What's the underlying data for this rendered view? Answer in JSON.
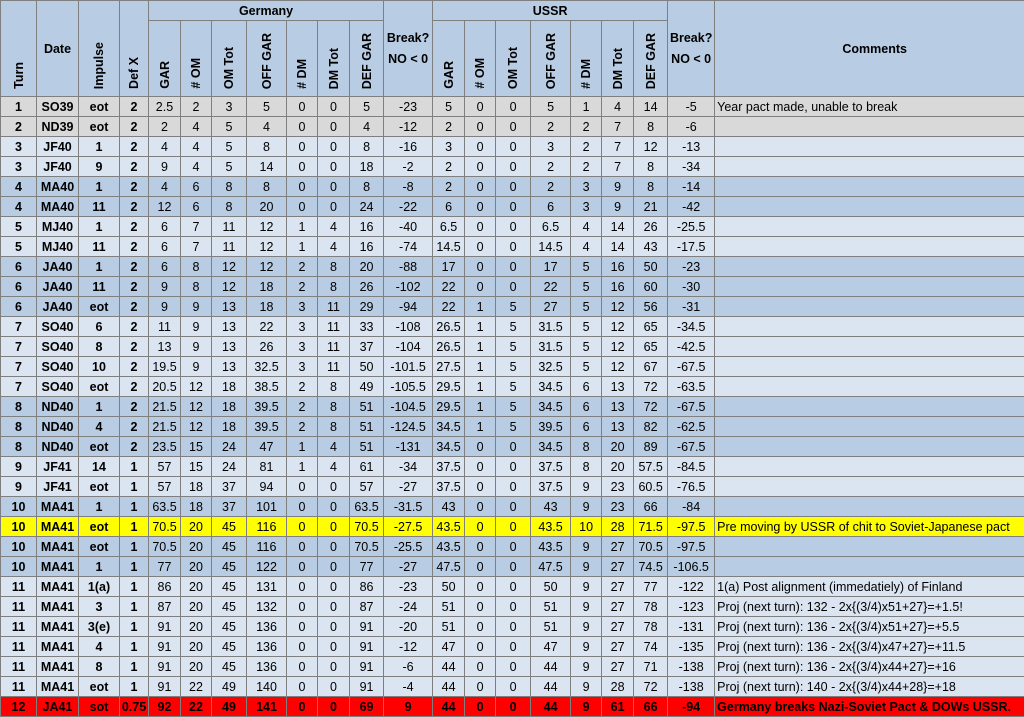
{
  "headers": {
    "turn": "Turn",
    "date": "Date",
    "impulse": "Impulse",
    "defx": "Def X",
    "germany": "Germany",
    "ussr": "USSR",
    "gar": "GAR",
    "om": "# OM",
    "omtot": "OM Tot",
    "offgar": "OFF GAR",
    "dm": "# DM",
    "dmtot": "DM Tot",
    "defgar": "DEF GAR",
    "break1": "Break?",
    "break2": "NO < 0",
    "comments": "Comments"
  },
  "rows": [
    {
      "style": "gray",
      "turn": "1",
      "date": "SO39",
      "impulse": "eot",
      "defx": "2",
      "g": [
        "2.5",
        "2",
        "3",
        "5",
        "0",
        "0",
        "5"
      ],
      "gbrk": "-23",
      "u": [
        "5",
        "0",
        "0",
        "5",
        "1",
        "4",
        "14"
      ],
      "ubrk": "-5",
      "comment": "Year pact made, unable to break"
    },
    {
      "style": "gray",
      "turn": "2",
      "date": "ND39",
      "impulse": "eot",
      "defx": "2",
      "g": [
        "2",
        "4",
        "5",
        "4",
        "0",
        "0",
        "4"
      ],
      "gbrk": "-12",
      "u": [
        "2",
        "0",
        "0",
        "2",
        "2",
        "7",
        "8"
      ],
      "ubrk": "-6",
      "comment": ""
    },
    {
      "style": "light",
      "turn": "3",
      "date": "JF40",
      "impulse": "1",
      "defx": "2",
      "g": [
        "4",
        "4",
        "5",
        "8",
        "0",
        "0",
        "8"
      ],
      "gbrk": "-16",
      "u": [
        "3",
        "0",
        "0",
        "3",
        "2",
        "7",
        "12"
      ],
      "ubrk": "-13",
      "comment": ""
    },
    {
      "style": "light",
      "turn": "3",
      "date": "JF40",
      "impulse": "9",
      "defx": "2",
      "g": [
        "9",
        "4",
        "5",
        "14",
        "0",
        "0",
        "18"
      ],
      "gbrk": "-2",
      "u": [
        "2",
        "0",
        "0",
        "2",
        "2",
        "7",
        "8"
      ],
      "ubrk": "-34",
      "comment": ""
    },
    {
      "style": "dark",
      "turn": "4",
      "date": "MA40",
      "impulse": "1",
      "defx": "2",
      "g": [
        "4",
        "6",
        "8",
        "8",
        "0",
        "0",
        "8"
      ],
      "gbrk": "-8",
      "u": [
        "2",
        "0",
        "0",
        "2",
        "3",
        "9",
        "8"
      ],
      "ubrk": "-14",
      "comment": ""
    },
    {
      "style": "dark",
      "turn": "4",
      "date": "MA40",
      "impulse": "11",
      "defx": "2",
      "g": [
        "12",
        "6",
        "8",
        "20",
        "0",
        "0",
        "24"
      ],
      "gbrk": "-22",
      "u": [
        "6",
        "0",
        "0",
        "6",
        "3",
        "9",
        "21"
      ],
      "ubrk": "-42",
      "comment": ""
    },
    {
      "style": "light",
      "turn": "5",
      "date": "MJ40",
      "impulse": "1",
      "defx": "2",
      "g": [
        "6",
        "7",
        "11",
        "12",
        "1",
        "4",
        "16"
      ],
      "gbrk": "-40",
      "u": [
        "6.5",
        "0",
        "0",
        "6.5",
        "4",
        "14",
        "26"
      ],
      "ubrk": "-25.5",
      "comment": ""
    },
    {
      "style": "light",
      "turn": "5",
      "date": "MJ40",
      "impulse": "11",
      "defx": "2",
      "g": [
        "6",
        "7",
        "11",
        "12",
        "1",
        "4",
        "16"
      ],
      "gbrk": "-74",
      "u": [
        "14.5",
        "0",
        "0",
        "14.5",
        "4",
        "14",
        "43"
      ],
      "ubrk": "-17.5",
      "comment": ""
    },
    {
      "style": "dark",
      "turn": "6",
      "date": "JA40",
      "impulse": "1",
      "defx": "2",
      "g": [
        "6",
        "8",
        "12",
        "12",
        "2",
        "8",
        "20"
      ],
      "gbrk": "-88",
      "u": [
        "17",
        "0",
        "0",
        "17",
        "5",
        "16",
        "50"
      ],
      "ubrk": "-23",
      "comment": ""
    },
    {
      "style": "dark",
      "turn": "6",
      "date": "JA40",
      "impulse": "11",
      "defx": "2",
      "g": [
        "9",
        "8",
        "12",
        "18",
        "2",
        "8",
        "26"
      ],
      "gbrk": "-102",
      "u": [
        "22",
        "0",
        "0",
        "22",
        "5",
        "16",
        "60"
      ],
      "ubrk": "-30",
      "comment": ""
    },
    {
      "style": "dark",
      "turn": "6",
      "date": "JA40",
      "impulse": "eot",
      "defx": "2",
      "g": [
        "9",
        "9",
        "13",
        "18",
        "3",
        "11",
        "29"
      ],
      "gbrk": "-94",
      "u": [
        "22",
        "1",
        "5",
        "27",
        "5",
        "12",
        "56"
      ],
      "ubrk": "-31",
      "comment": ""
    },
    {
      "style": "light",
      "turn": "7",
      "date": "SO40",
      "impulse": "6",
      "defx": "2",
      "g": [
        "11",
        "9",
        "13",
        "22",
        "3",
        "11",
        "33"
      ],
      "gbrk": "-108",
      "u": [
        "26.5",
        "1",
        "5",
        "31.5",
        "5",
        "12",
        "65"
      ],
      "ubrk": "-34.5",
      "comment": ""
    },
    {
      "style": "light",
      "turn": "7",
      "date": "SO40",
      "impulse": "8",
      "defx": "2",
      "g": [
        "13",
        "9",
        "13",
        "26",
        "3",
        "11",
        "37"
      ],
      "gbrk": "-104",
      "u": [
        "26.5",
        "1",
        "5",
        "31.5",
        "5",
        "12",
        "65"
      ],
      "ubrk": "-42.5",
      "comment": ""
    },
    {
      "style": "light",
      "turn": "7",
      "date": "SO40",
      "impulse": "10",
      "defx": "2",
      "g": [
        "19.5",
        "9",
        "13",
        "32.5",
        "3",
        "11",
        "50"
      ],
      "gbrk": "-101.5",
      "u": [
        "27.5",
        "1",
        "5",
        "32.5",
        "5",
        "12",
        "67"
      ],
      "ubrk": "-67.5",
      "comment": ""
    },
    {
      "style": "light",
      "turn": "7",
      "date": "SO40",
      "impulse": "eot",
      "defx": "2",
      "g": [
        "20.5",
        "12",
        "18",
        "38.5",
        "2",
        "8",
        "49"
      ],
      "gbrk": "-105.5",
      "u": [
        "29.5",
        "1",
        "5",
        "34.5",
        "6",
        "13",
        "72"
      ],
      "ubrk": "-63.5",
      "comment": ""
    },
    {
      "style": "dark",
      "turn": "8",
      "date": "ND40",
      "impulse": "1",
      "defx": "2",
      "g": [
        "21.5",
        "12",
        "18",
        "39.5",
        "2",
        "8",
        "51"
      ],
      "gbrk": "-104.5",
      "u": [
        "29.5",
        "1",
        "5",
        "34.5",
        "6",
        "13",
        "72"
      ],
      "ubrk": "-67.5",
      "comment": ""
    },
    {
      "style": "dark",
      "turn": "8",
      "date": "ND40",
      "impulse": "4",
      "defx": "2",
      "g": [
        "21.5",
        "12",
        "18",
        "39.5",
        "2",
        "8",
        "51"
      ],
      "gbrk": "-124.5",
      "u": [
        "34.5",
        "1",
        "5",
        "39.5",
        "6",
        "13",
        "82"
      ],
      "ubrk": "-62.5",
      "comment": ""
    },
    {
      "style": "dark",
      "turn": "8",
      "date": "ND40",
      "impulse": "eot",
      "defx": "2",
      "g": [
        "23.5",
        "15",
        "24",
        "47",
        "1",
        "4",
        "51"
      ],
      "gbrk": "-131",
      "u": [
        "34.5",
        "0",
        "0",
        "34.5",
        "8",
        "20",
        "89"
      ],
      "ubrk": "-67.5",
      "comment": ""
    },
    {
      "style": "light",
      "turn": "9",
      "date": "JF41",
      "impulse": "14",
      "defx": "1",
      "g": [
        "57",
        "15",
        "24",
        "81",
        "1",
        "4",
        "61"
      ],
      "gbrk": "-34",
      "u": [
        "37.5",
        "0",
        "0",
        "37.5",
        "8",
        "20",
        "57.5"
      ],
      "ubrk": "-84.5",
      "comment": ""
    },
    {
      "style": "light",
      "turn": "9",
      "date": "JF41",
      "impulse": "eot",
      "defx": "1",
      "g": [
        "57",
        "18",
        "37",
        "94",
        "0",
        "0",
        "57"
      ],
      "gbrk": "-27",
      "u": [
        "37.5",
        "0",
        "0",
        "37.5",
        "9",
        "23",
        "60.5"
      ],
      "ubrk": "-76.5",
      "comment": ""
    },
    {
      "style": "dark",
      "turn": "10",
      "date": "MA41",
      "impulse": "1",
      "defx": "1",
      "g": [
        "63.5",
        "18",
        "37",
        "101",
        "0",
        "0",
        "63.5"
      ],
      "gbrk": "-31.5",
      "u": [
        "43",
        "0",
        "0",
        "43",
        "9",
        "23",
        "66"
      ],
      "ubrk": "-84",
      "comment": ""
    },
    {
      "style": "yellow",
      "turn": "10",
      "date": "MA41",
      "impulse": "eot",
      "defx": "1",
      "g": [
        "70.5",
        "20",
        "45",
        "116",
        "0",
        "0",
        "70.5"
      ],
      "gbrk": "-27.5",
      "u": [
        "43.5",
        "0",
        "0",
        "43.5",
        "10",
        "28",
        "71.5"
      ],
      "ubrk": "-97.5",
      "comment": "Pre moving by USSR of chit to Soviet-Japanese pact"
    },
    {
      "style": "dark",
      "turn": "10",
      "date": "MA41",
      "impulse": "eot",
      "defx": "1",
      "g": [
        "70.5",
        "20",
        "45",
        "116",
        "0",
        "0",
        "70.5"
      ],
      "gbrk": "-25.5",
      "u": [
        "43.5",
        "0",
        "0",
        "43.5",
        "9",
        "27",
        "70.5"
      ],
      "ubrk": "-97.5",
      "comment": ""
    },
    {
      "style": "dark",
      "turn": "10",
      "date": "MA41",
      "impulse": "1",
      "defx": "1",
      "g": [
        "77",
        "20",
        "45",
        "122",
        "0",
        "0",
        "77"
      ],
      "gbrk": "-27",
      "u": [
        "47.5",
        "0",
        "0",
        "47.5",
        "9",
        "27",
        "74.5"
      ],
      "ubrk": "-106.5",
      "comment": ""
    },
    {
      "style": "light",
      "turn": "11",
      "date": "MA41",
      "impulse": "1(a)",
      "defx": "1",
      "g": [
        "86",
        "20",
        "45",
        "131",
        "0",
        "0",
        "86"
      ],
      "gbrk": "-23",
      "u": [
        "50",
        "0",
        "0",
        "50",
        "9",
        "27",
        "77"
      ],
      "ubrk": "-122",
      "comment": "1(a) Post alignment (immedatiely) of Finland"
    },
    {
      "style": "light",
      "turn": "11",
      "date": "MA41",
      "impulse": "3",
      "defx": "1",
      "g": [
        "87",
        "20",
        "45",
        "132",
        "0",
        "0",
        "87"
      ],
      "gbrk": "-24",
      "u": [
        "51",
        "0",
        "0",
        "51",
        "9",
        "27",
        "78"
      ],
      "ubrk": "-123",
      "comment": "Proj (next turn): 132 - 2x{(3/4)x51+27}=+1.5!"
    },
    {
      "style": "light",
      "turn": "11",
      "date": "MA41",
      "impulse": "3(e)",
      "defx": "1",
      "g": [
        "91",
        "20",
        "45",
        "136",
        "0",
        "0",
        "91"
      ],
      "gbrk": "-20",
      "u": [
        "51",
        "0",
        "0",
        "51",
        "9",
        "27",
        "78"
      ],
      "ubrk": "-131",
      "comment": "Proj (next turn): 136 - 2x{(3/4)x51+27}=+5.5"
    },
    {
      "style": "light",
      "turn": "11",
      "date": "MA41",
      "impulse": "4",
      "defx": "1",
      "g": [
        "91",
        "20",
        "45",
        "136",
        "0",
        "0",
        "91"
      ],
      "gbrk": "-12",
      "u": [
        "47",
        "0",
        "0",
        "47",
        "9",
        "27",
        "74"
      ],
      "ubrk": "-135",
      "comment": "Proj (next turn): 136 - 2x{(3/4)x47+27}=+11.5"
    },
    {
      "style": "light",
      "turn": "11",
      "date": "MA41",
      "impulse": "8",
      "defx": "1",
      "g": [
        "91",
        "20",
        "45",
        "136",
        "0",
        "0",
        "91"
      ],
      "gbrk": "-6",
      "u": [
        "44",
        "0",
        "0",
        "44",
        "9",
        "27",
        "71"
      ],
      "ubrk": "-138",
      "comment": "Proj (next turn): 136 - 2x{(3/4)x44+27}=+16"
    },
    {
      "style": "light",
      "turn": "11",
      "date": "MA41",
      "impulse": "eot",
      "defx": "1",
      "g": [
        "91",
        "22",
        "49",
        "140",
        "0",
        "0",
        "91"
      ],
      "gbrk": "-4",
      "u": [
        "44",
        "0",
        "0",
        "44",
        "9",
        "28",
        "72"
      ],
      "ubrk": "-138",
      "comment": "Proj (next turn): 140 - 2x{(3/4)x44+28}=+18"
    },
    {
      "style": "red",
      "turn": "12",
      "date": "JA41",
      "impulse": "sot",
      "defx": "0.75",
      "g": [
        "92",
        "22",
        "49",
        "141",
        "0",
        "0",
        "69"
      ],
      "gbrk": "9",
      "u": [
        "44",
        "0",
        "0",
        "44",
        "9",
        "61",
        "66"
      ],
      "ubrk": "-94",
      "comment": "Germany breaks Nazi-Soviet Pact & DOWs USSR."
    }
  ]
}
